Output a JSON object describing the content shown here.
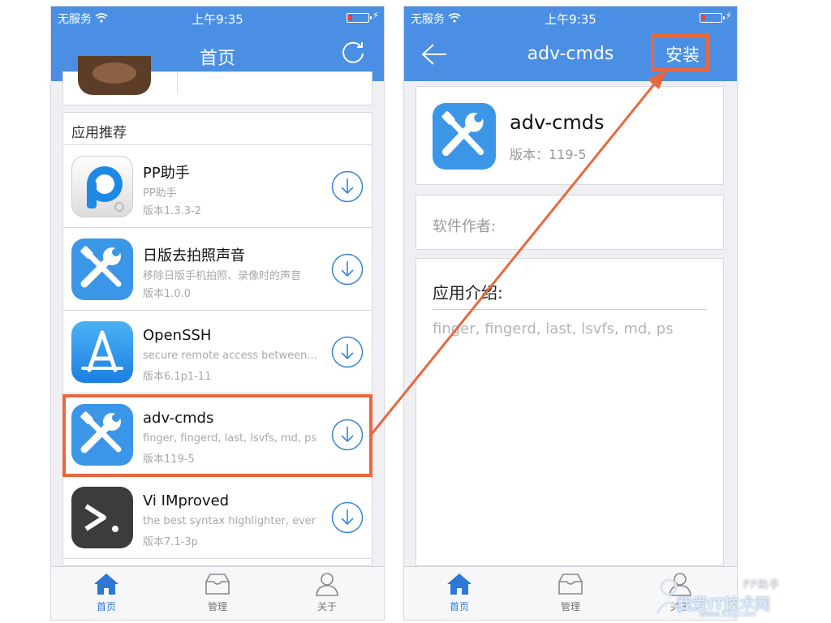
{
  "colors": {
    "nav_blue": "#4a8fe4",
    "highlight_orange": "#e8683e",
    "download_blue": "#3a86d8",
    "tab_active": "#2d78d6"
  },
  "status_bar": {
    "carrier": "无服务",
    "time": "上午9:35"
  },
  "left_screen": {
    "nav_title": "首页",
    "refresh_icon": "refresh-icon",
    "section_title": "应用推荐",
    "apps": [
      {
        "name": "PP助手",
        "desc": "PP助手",
        "version": "版本1.3.3-2",
        "icon": "pp-assistant-icon"
      },
      {
        "name": "日版去拍照声音",
        "desc": "移除日版手机拍照、录像时的声音",
        "version": "版本1.0.0",
        "icon": "tools-icon"
      },
      {
        "name": "OpenSSH",
        "desc": "secure remote access between...",
        "version": "版本6.1p1-11",
        "icon": "app-store-icon"
      },
      {
        "name": "adv-cmds",
        "desc": "finger, fingerd, last, lsvfs, md, ps",
        "version": "版本119-5",
        "icon": "tools-icon"
      },
      {
        "name": "Vi IMproved",
        "desc": "the best syntax highlighter, ever",
        "version": "版本7.1-3p",
        "icon": "vim-terminal-icon"
      }
    ],
    "highlighted_app": "adv-cmds"
  },
  "right_screen": {
    "nav_title": "adv-cmds",
    "install_label": "安装",
    "app_name": "adv-cmds",
    "version": "版本：119-5",
    "author_label": "软件作者:",
    "intro_title": "应用介绍:",
    "intro_text": "finger, fingerd, last, lsvfs, md, ps"
  },
  "tabs": [
    {
      "label": "首页",
      "icon": "home-icon",
      "active": true
    },
    {
      "label": "管理",
      "icon": "manage-box-icon",
      "active": false
    },
    {
      "label": "关于",
      "icon": "person-icon",
      "active": false
    }
  ],
  "watermark": {
    "text": "我爱IT技术网",
    "url": "www.52ij.com",
    "logo": "PP助手"
  }
}
